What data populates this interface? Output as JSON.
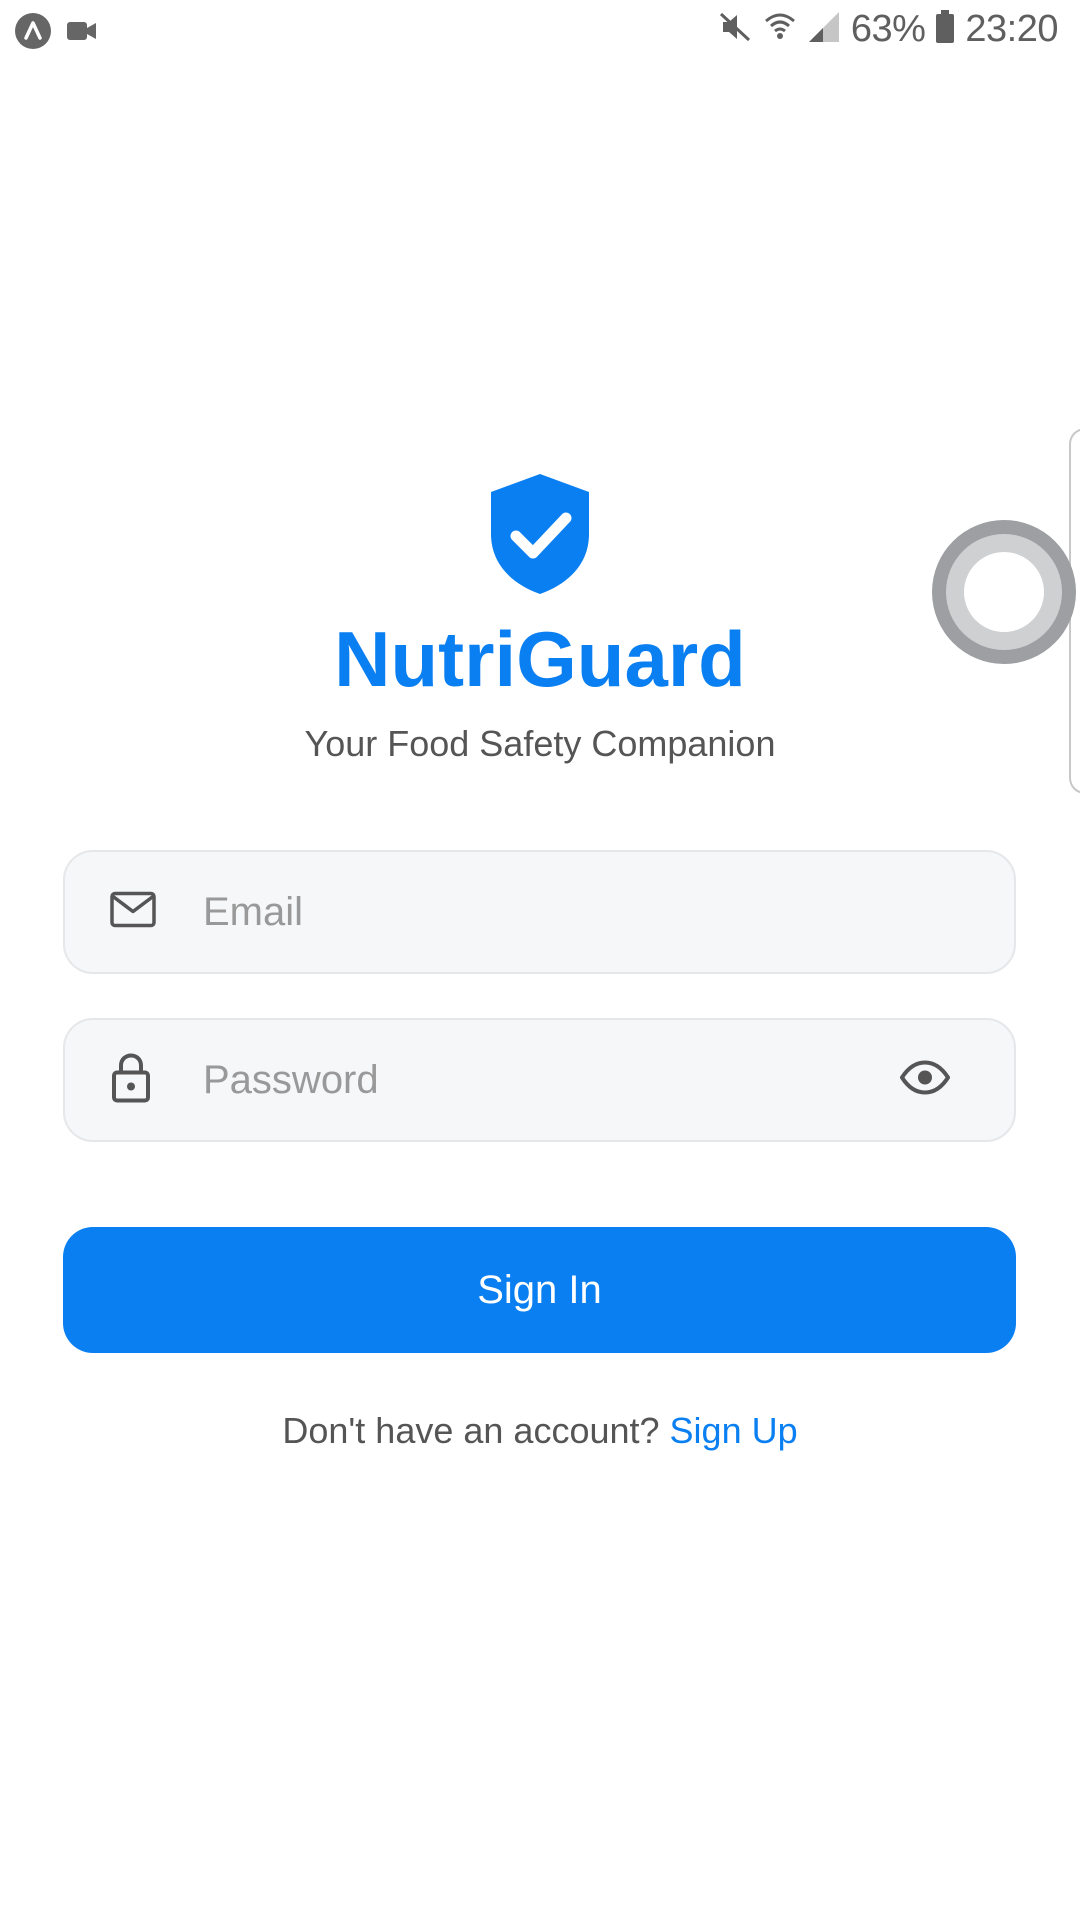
{
  "status_bar": {
    "battery_percent": "63%",
    "time": "23:20",
    "icons": [
      "app-a-icon",
      "video-camera-icon",
      "mute-icon",
      "wifi-icon",
      "signal-icon",
      "battery-icon"
    ]
  },
  "brand": {
    "logo_icon": "shield-check-icon",
    "app_name": "NutriGuard",
    "tagline": "Your Food Safety Companion",
    "accent_color": "#0a7ff2"
  },
  "form": {
    "email": {
      "placeholder": "Email",
      "value": "",
      "icon": "mail-icon"
    },
    "password": {
      "placeholder": "Password",
      "value": "",
      "icon": "lock-icon",
      "toggle_icon": "eye-icon"
    },
    "submit_label": "Sign In"
  },
  "footer": {
    "prompt": "Don't have an account? ",
    "link_label": "Sign Up"
  }
}
